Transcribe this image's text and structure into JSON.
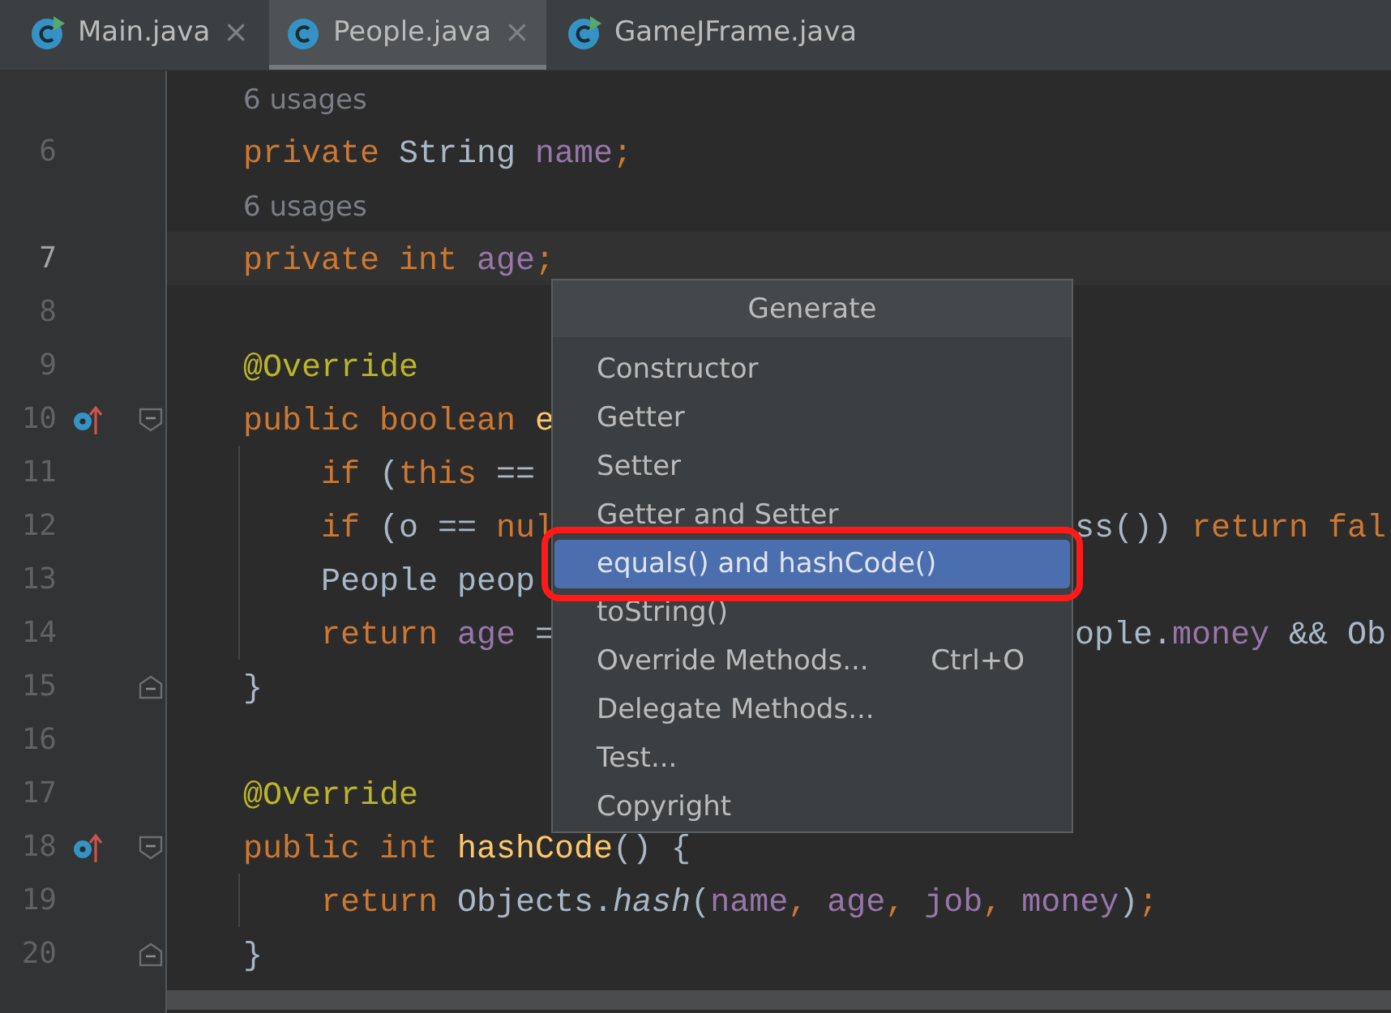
{
  "tabs": [
    {
      "label": "Main.java",
      "runnable": true,
      "selected": false,
      "close": "×"
    },
    {
      "label": "People.java",
      "runnable": false,
      "selected": true,
      "close": "×"
    },
    {
      "label": "GameJFrame.java",
      "runnable": true,
      "selected": false
    }
  ],
  "lines": [
    {
      "kind": "usages",
      "text": "6 usages"
    },
    {
      "kind": "code",
      "number": "6",
      "current": false,
      "tokens": [
        {
          "kind": "keyword",
          "text": "private "
        },
        {
          "kind": "plain",
          "text": "String "
        },
        {
          "kind": "field",
          "text": "name"
        },
        {
          "kind": "keyword",
          "text": ";"
        }
      ]
    },
    {
      "kind": "usages",
      "text": "6 usages"
    },
    {
      "kind": "code",
      "number": "7",
      "current": true,
      "tokens": [
        {
          "kind": "keyword",
          "text": "private int "
        },
        {
          "kind": "field",
          "text": "age"
        },
        {
          "kind": "keyword",
          "text": ";"
        }
      ]
    },
    {
      "kind": "code",
      "number": "8",
      "current": false
    },
    {
      "kind": "code",
      "number": "9",
      "current": false,
      "tokens": [
        {
          "kind": "annotation",
          "text": "@Override"
        }
      ]
    },
    {
      "kind": "code",
      "number": "10",
      "current": false,
      "overrides": true,
      "fold_open": true,
      "tokens": [
        {
          "kind": "keyword",
          "text": "public boolean "
        },
        {
          "kind": "method",
          "text": "e"
        }
      ]
    },
    {
      "kind": "code",
      "number": "11",
      "current": false,
      "inner": true,
      "tokens": [
        {
          "kind": "keyword",
          "text": "if"
        },
        {
          "kind": "plain",
          "text": " ("
        },
        {
          "kind": "keyword",
          "text": "this"
        },
        {
          "kind": "plain",
          "text": " =="
        }
      ]
    },
    {
      "kind": "code",
      "number": "12",
      "current": false,
      "inner": true,
      "tokens": [
        {
          "kind": "keyword",
          "text": "if"
        },
        {
          "kind": "plain",
          "text": " (o == "
        },
        {
          "kind": "keyword",
          "text": "nul"
        }
      ],
      "tail": [
        {
          "kind": "plain",
          "text": "ss()) "
        },
        {
          "kind": "keyword",
          "text": "return fal"
        }
      ]
    },
    {
      "kind": "code",
      "number": "13",
      "current": false,
      "inner": true,
      "tokens": [
        {
          "kind": "plain",
          "text": "People peop"
        }
      ]
    },
    {
      "kind": "code",
      "number": "14",
      "current": false,
      "inner": true,
      "tokens": [
        {
          "kind": "keyword",
          "text": "return "
        },
        {
          "kind": "field",
          "text": "age"
        },
        {
          "kind": "plain",
          "text": " ="
        }
      ],
      "tail": [
        {
          "kind": "plain",
          "text": "ople."
        },
        {
          "kind": "field",
          "text": "money"
        },
        {
          "kind": "plain",
          "text": " && Ob"
        }
      ]
    },
    {
      "kind": "code",
      "number": "15",
      "current": false,
      "fold_close": true,
      "tokens": [
        {
          "kind": "plain",
          "text": "}"
        }
      ]
    },
    {
      "kind": "code",
      "number": "16",
      "current": false
    },
    {
      "kind": "code",
      "number": "17",
      "current": false,
      "tokens": [
        {
          "kind": "annotation",
          "text": "@Override"
        }
      ]
    },
    {
      "kind": "code",
      "number": "18",
      "current": false,
      "overrides": true,
      "fold_open": true,
      "tokens": [
        {
          "kind": "keyword",
          "text": "public int "
        },
        {
          "kind": "method",
          "text": "hashCode"
        },
        {
          "kind": "plain",
          "text": "() {"
        }
      ]
    },
    {
      "kind": "code",
      "number": "19",
      "current": false,
      "inner": true,
      "tokens": [
        {
          "kind": "keyword",
          "text": "return "
        },
        {
          "kind": "plain",
          "text": "Objects."
        },
        {
          "kind": "static",
          "text": "hash"
        },
        {
          "kind": "plain",
          "text": "("
        },
        {
          "kind": "field",
          "text": "name"
        },
        {
          "kind": "keyword",
          "text": ", "
        },
        {
          "kind": "field",
          "text": "age"
        },
        {
          "kind": "keyword",
          "text": ", "
        },
        {
          "kind": "field",
          "text": "job"
        },
        {
          "kind": "keyword",
          "text": ", "
        },
        {
          "kind": "field",
          "text": "money"
        },
        {
          "kind": "plain",
          "text": ")"
        },
        {
          "kind": "keyword",
          "text": ";"
        }
      ]
    },
    {
      "kind": "code",
      "number": "20",
      "current": false,
      "fold_close": true,
      "tokens": [
        {
          "kind": "plain",
          "text": "}"
        }
      ]
    }
  ],
  "popup": {
    "title": "Generate",
    "items": [
      {
        "label": "Constructor",
        "selected": false,
        "framed": false
      },
      {
        "label": "Getter",
        "selected": false,
        "framed": false
      },
      {
        "label": "Setter",
        "selected": false,
        "framed": false
      },
      {
        "label": "Getter and Setter",
        "selected": false,
        "framed": false
      },
      {
        "label": "equals() and hashCode()",
        "selected": true,
        "framed": true
      },
      {
        "label": "toString()",
        "selected": false,
        "framed": false
      },
      {
        "label": "Override Methods...",
        "shortcut": "Ctrl+O",
        "selected": false,
        "framed": false
      },
      {
        "label": "Delegate Methods...",
        "selected": false,
        "framed": false
      },
      {
        "label": "Test...",
        "selected": false,
        "framed": false
      },
      {
        "label": "Copyright",
        "selected": false,
        "framed": false
      }
    ]
  }
}
